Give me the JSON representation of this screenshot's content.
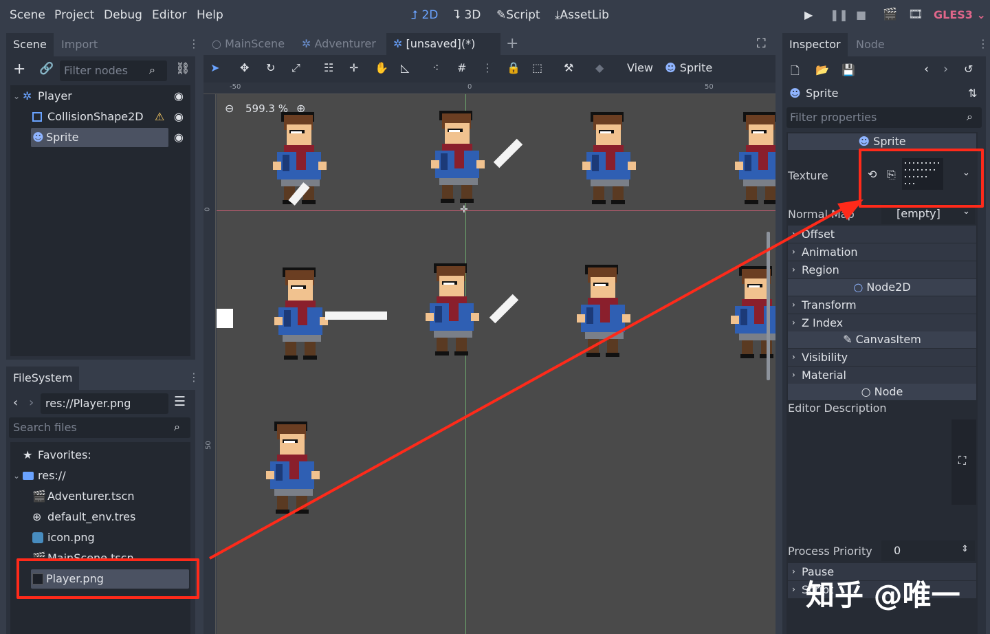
{
  "menu": {
    "items": [
      "Scene",
      "Project",
      "Debug",
      "Editor",
      "Help"
    ]
  },
  "modes": {
    "d2": "2D",
    "d3": "3D",
    "script": "Script",
    "assetlib": "AssetLib"
  },
  "renderer": "GLES3",
  "scene_dock": {
    "tabs": [
      "Scene",
      "Import"
    ],
    "filter_placeholder": "Filter nodes",
    "nodes": [
      {
        "label": "Player",
        "icon": "kinematic-body-icon"
      },
      {
        "label": "CollisionShape2D",
        "icon": "collision-shape-icon"
      },
      {
        "label": "Sprite",
        "icon": "sprite-icon"
      }
    ]
  },
  "filesystem": {
    "tab": "FileSystem",
    "path": "res://Player.png",
    "search_placeholder": "Search files",
    "favorites": "Favorites:",
    "root": "res://",
    "files": [
      "Adventurer.tscn",
      "default_env.tres",
      "icon.png",
      "MainScene.tscn",
      "Player.png"
    ]
  },
  "editor": {
    "tabs": [
      "MainScene",
      "Adventurer",
      "[unsaved](*)"
    ],
    "toolbar": {
      "view": "View",
      "sprite": "Sprite"
    },
    "zoom": "599.3 %",
    "ruler": {
      "neg50": "-50",
      "zero": "0",
      "pos50": "50",
      "v0": "0",
      "v50": "50"
    }
  },
  "inspector": {
    "tabs": [
      "Inspector",
      "Node"
    ],
    "object": "Sprite",
    "filter_placeholder": "Filter properties",
    "class_sprite": "Sprite",
    "texture_label": "Texture",
    "normal_map_label": "Normal Map",
    "normal_map_value": "[empty]",
    "sprite_groups": [
      "Offset",
      "Animation",
      "Region"
    ],
    "class_node2d": "Node2D",
    "node2d_groups": [
      "Transform",
      "Z Index"
    ],
    "class_canvasitem": "CanvasItem",
    "canvasitem_groups": [
      "Visibility",
      "Material"
    ],
    "class_node": "Node",
    "editor_description": "Editor Description",
    "process_priority_label": "Process Priority",
    "process_priority_value": "0",
    "node_groups": [
      "Pause",
      "Script"
    ]
  },
  "watermark": "知乎 @唯一",
  "colors": {
    "accent": "#6aa3ff",
    "annotation": "#ff2a1a",
    "renderer": "#e0668a",
    "warning": "#ffd166"
  }
}
